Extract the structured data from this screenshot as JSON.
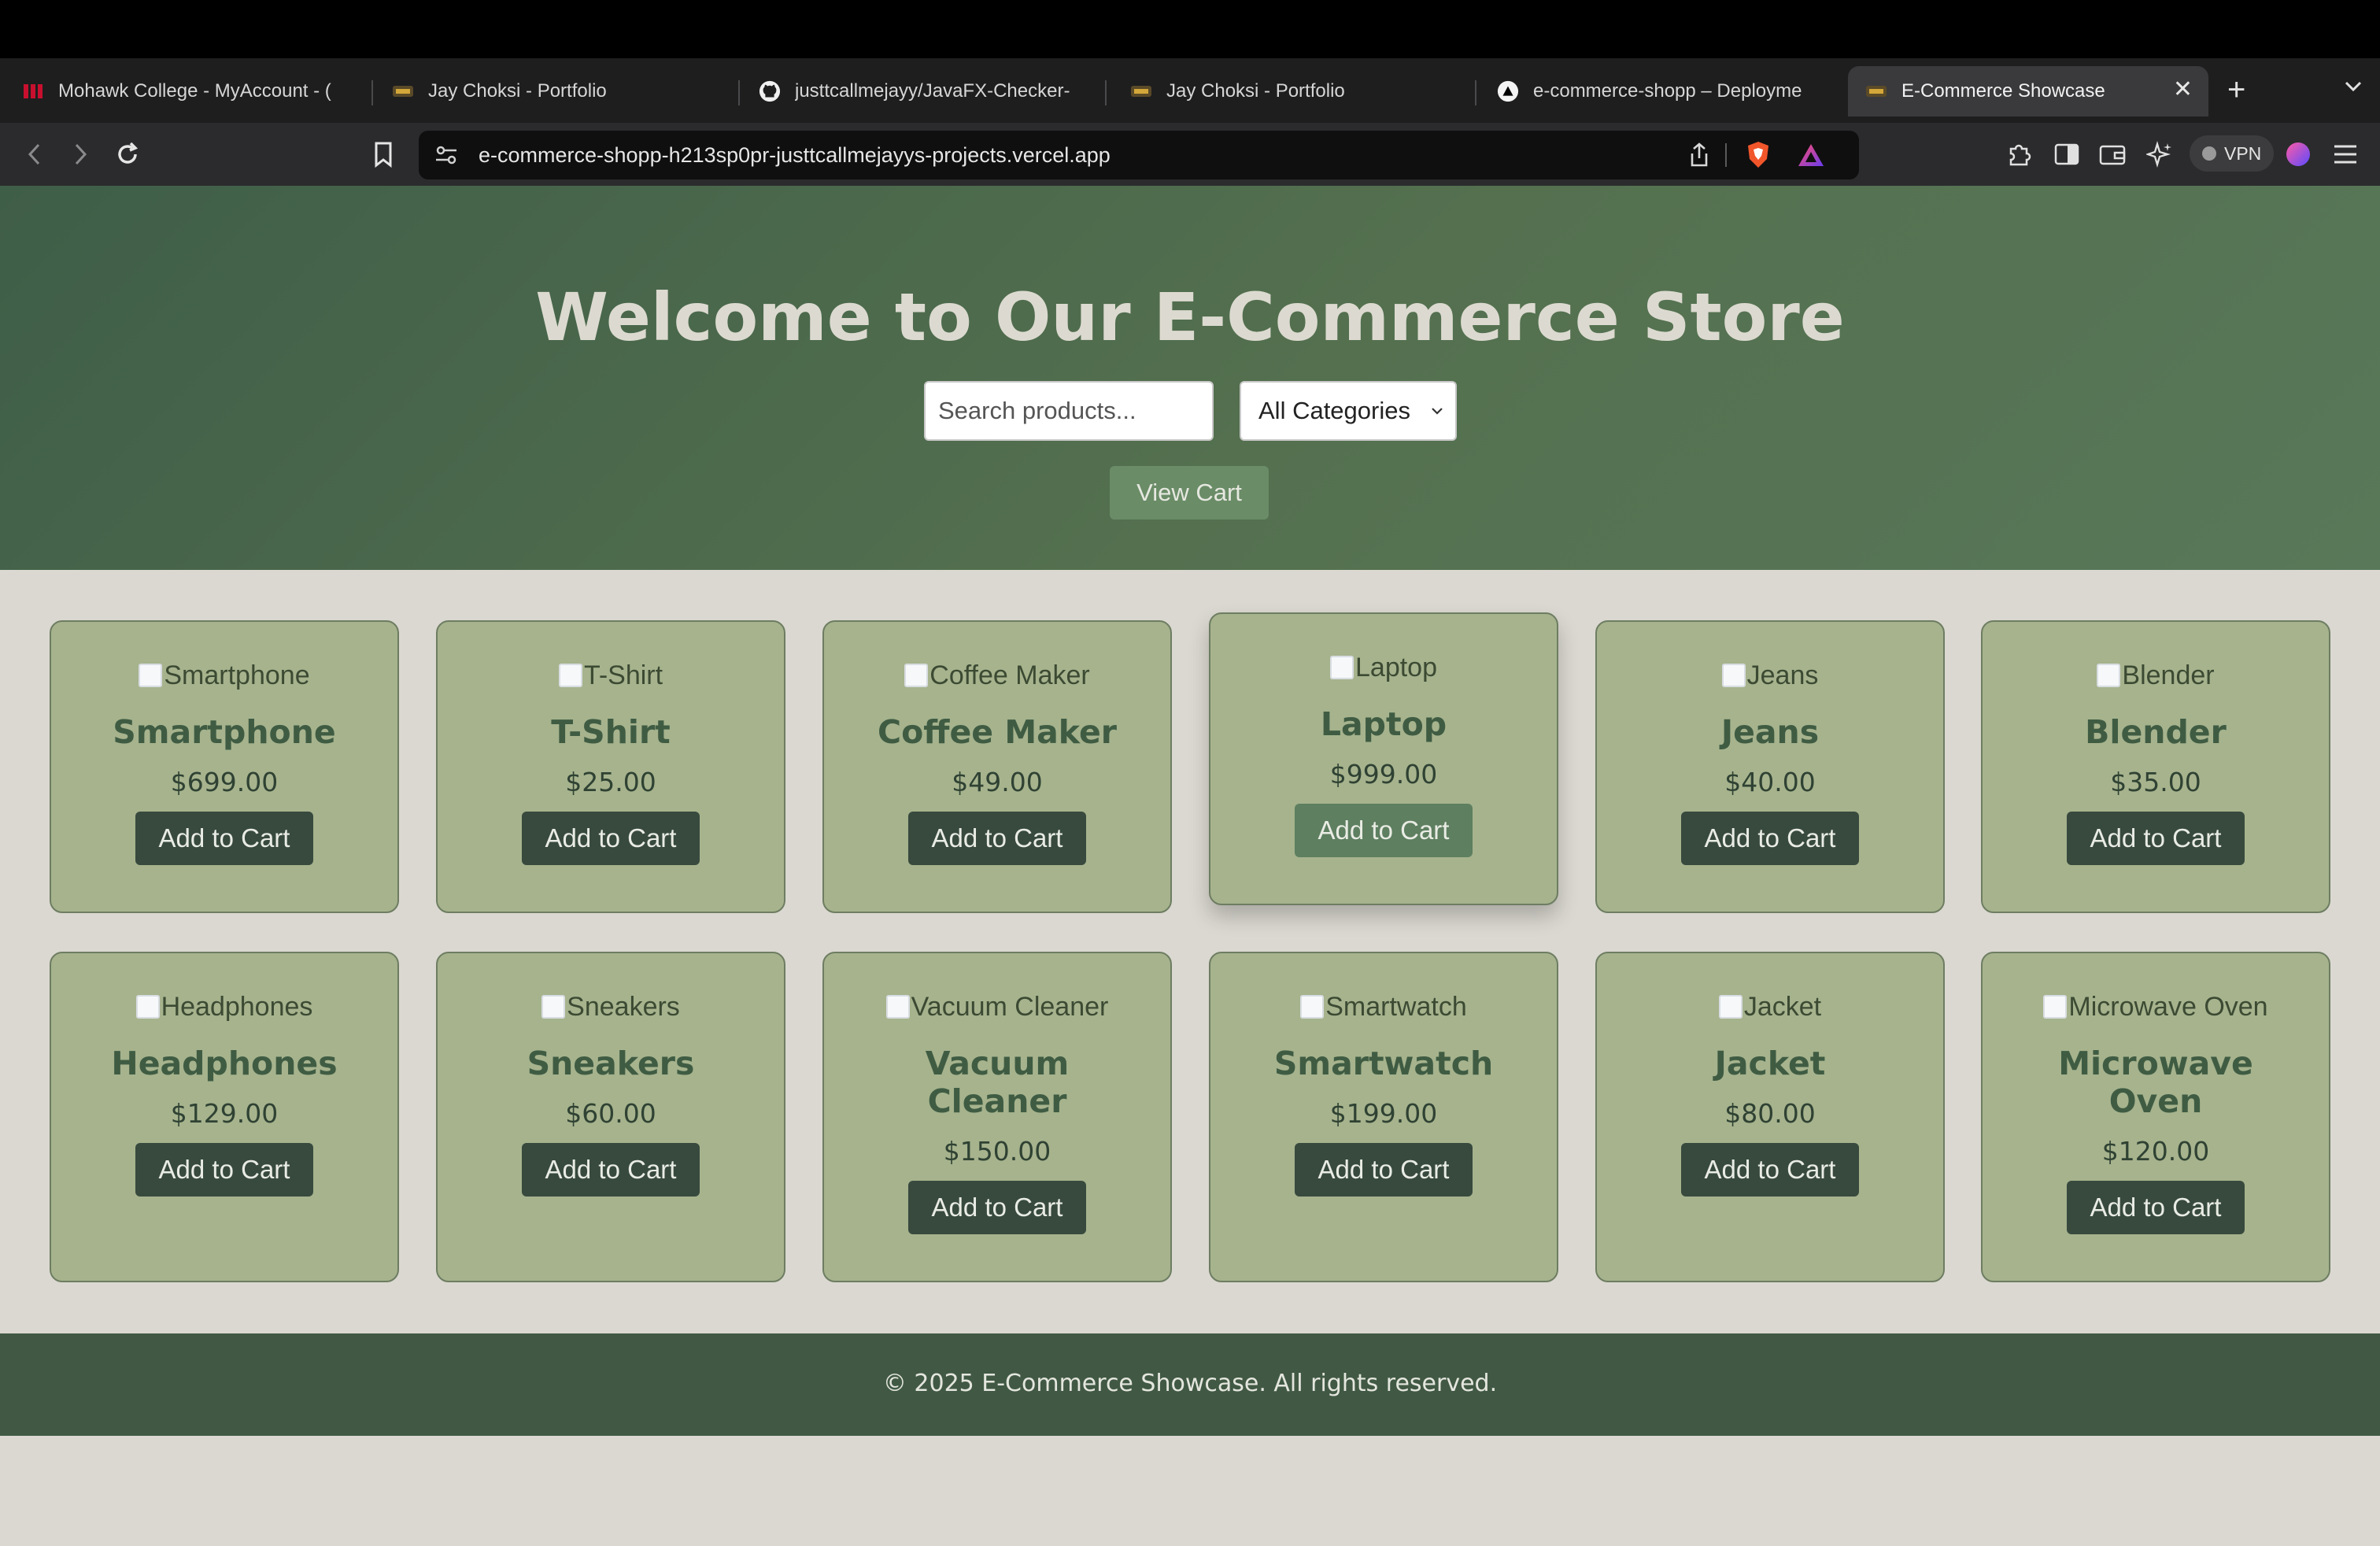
{
  "browser": {
    "tabs": [
      {
        "title": "Mohawk College - MyAccount - (",
        "icon": "mohawk-icon"
      },
      {
        "title": "Jay Choksi - Portfolio",
        "icon": "portfolio-icon"
      },
      {
        "title": "justtcallmejayy/JavaFX-Checker-",
        "icon": "github-icon"
      },
      {
        "title": "Jay Choksi - Portfolio",
        "icon": "portfolio-icon"
      },
      {
        "title": "e-commerce-shopp – Deployme",
        "icon": "vercel-icon"
      },
      {
        "title": "E-Commerce Showcase",
        "icon": "portfolio-icon",
        "active": true
      }
    ],
    "url": "e-commerce-shopp-h213sp0pr-justtcallmejayys-projects.vercel.app",
    "vpn_label": "VPN"
  },
  "hero": {
    "title": "Welcome to Our E-Commerce Store",
    "search_placeholder": "Search products...",
    "category_selected": "All Categories",
    "view_cart_label": "View Cart"
  },
  "products": [
    {
      "image_alt": "Smartphone",
      "name": "Smartphone",
      "price": "$699.00",
      "button": "Add to Cart"
    },
    {
      "image_alt": "T-Shirt",
      "name": "T-Shirt",
      "price": "$25.00",
      "button": "Add to Cart"
    },
    {
      "image_alt": "Coffee Maker",
      "name": "Coffee Maker",
      "price": "$49.00",
      "button": "Add to Cart"
    },
    {
      "image_alt": "Laptop",
      "name": "Laptop",
      "price": "$999.00",
      "button": "Add to Cart"
    },
    {
      "image_alt": "Jeans",
      "name": "Jeans",
      "price": "$40.00",
      "button": "Add to Cart"
    },
    {
      "image_alt": "Blender",
      "name": "Blender",
      "price": "$35.00",
      "button": "Add to Cart"
    },
    {
      "image_alt": "Headphones",
      "name": "Headphones",
      "price": "$129.00",
      "button": "Add to Cart"
    },
    {
      "image_alt": "Sneakers",
      "name": "Sneakers",
      "price": "$60.00",
      "button": "Add to Cart"
    },
    {
      "image_alt": "Vacuum Cleaner",
      "name": "Vacuum Cleaner",
      "price": "$150.00",
      "button": "Add to Cart"
    },
    {
      "image_alt": "Smartwatch",
      "name": "Smartwatch",
      "price": "$199.00",
      "button": "Add to Cart"
    },
    {
      "image_alt": "Jacket",
      "name": "Jacket",
      "price": "$80.00",
      "button": "Add to Cart"
    },
    {
      "image_alt": "Microwave Oven",
      "name": "Microwave Oven",
      "price": "$120.00",
      "button": "Add to Cart"
    }
  ],
  "footer": {
    "text": "© 2025 E-Commerce Showcase. All rights reserved."
  },
  "colors": {
    "hero": "#4f6b4f",
    "card": "#a6b38d",
    "button": "#384a3e",
    "button_hover": "#5e7f60",
    "footer": "#415944",
    "page_bg": "#dad8d0"
  }
}
